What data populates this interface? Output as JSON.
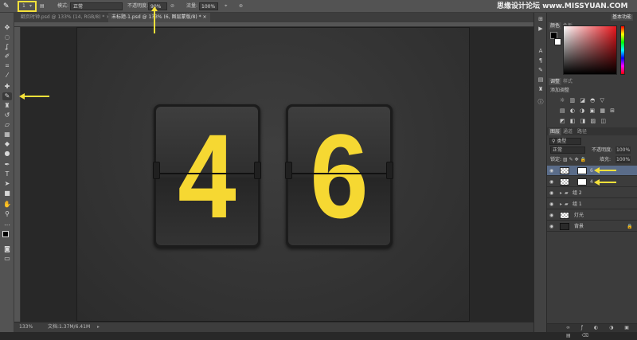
{
  "watermark": "思缘设计论坛 www.MISSYUAN.COM",
  "options_bar": {
    "brush_size": "1",
    "mode_label": "模式:",
    "mode_value": "正常",
    "opacity_label": "不透明度:",
    "opacity_value": "90%",
    "flow_label": "流量:",
    "flow_value": "100%"
  },
  "tabs": [
    {
      "label": "翻页时钟.psd @ 133% (14, RGB/8) *",
      "active": false
    },
    {
      "label": "未标题-1.psd @ 133% (6, 图层蒙版/8) *",
      "active": true
    }
  ],
  "digits": [
    "4",
    "6"
  ],
  "status": {
    "zoom": "133%",
    "doc": "文档:1.37M/6.41M"
  },
  "color_panel": {
    "tabs": [
      "颜色",
      "色板"
    ],
    "workspace": "基本功能"
  },
  "adjust_panel": {
    "tabs": [
      "调整",
      "样式"
    ],
    "title": "添加调整"
  },
  "layers_panel": {
    "tabs": [
      "图层",
      "通道",
      "路径"
    ],
    "filter": "类型",
    "blend": "正常",
    "opacity_label": "不透明度:",
    "opacity_value": "100%",
    "lock_label": "锁定:",
    "fill_label": "填充:",
    "fill_value": "100%",
    "layers": [
      {
        "name": "6",
        "selected": true,
        "type": "mask"
      },
      {
        "name": "4",
        "selected": false,
        "type": "mask"
      },
      {
        "name": "组 2",
        "selected": false,
        "type": "group"
      },
      {
        "name": "组 1",
        "selected": false,
        "type": "group"
      },
      {
        "name": "灯光",
        "selected": false,
        "type": "pixel"
      },
      {
        "name": "背景",
        "selected": false,
        "type": "background"
      }
    ]
  },
  "colors": {
    "accent": "#f5e13a",
    "digit": "#f6d832",
    "selected_layer": "#5a6c89"
  }
}
